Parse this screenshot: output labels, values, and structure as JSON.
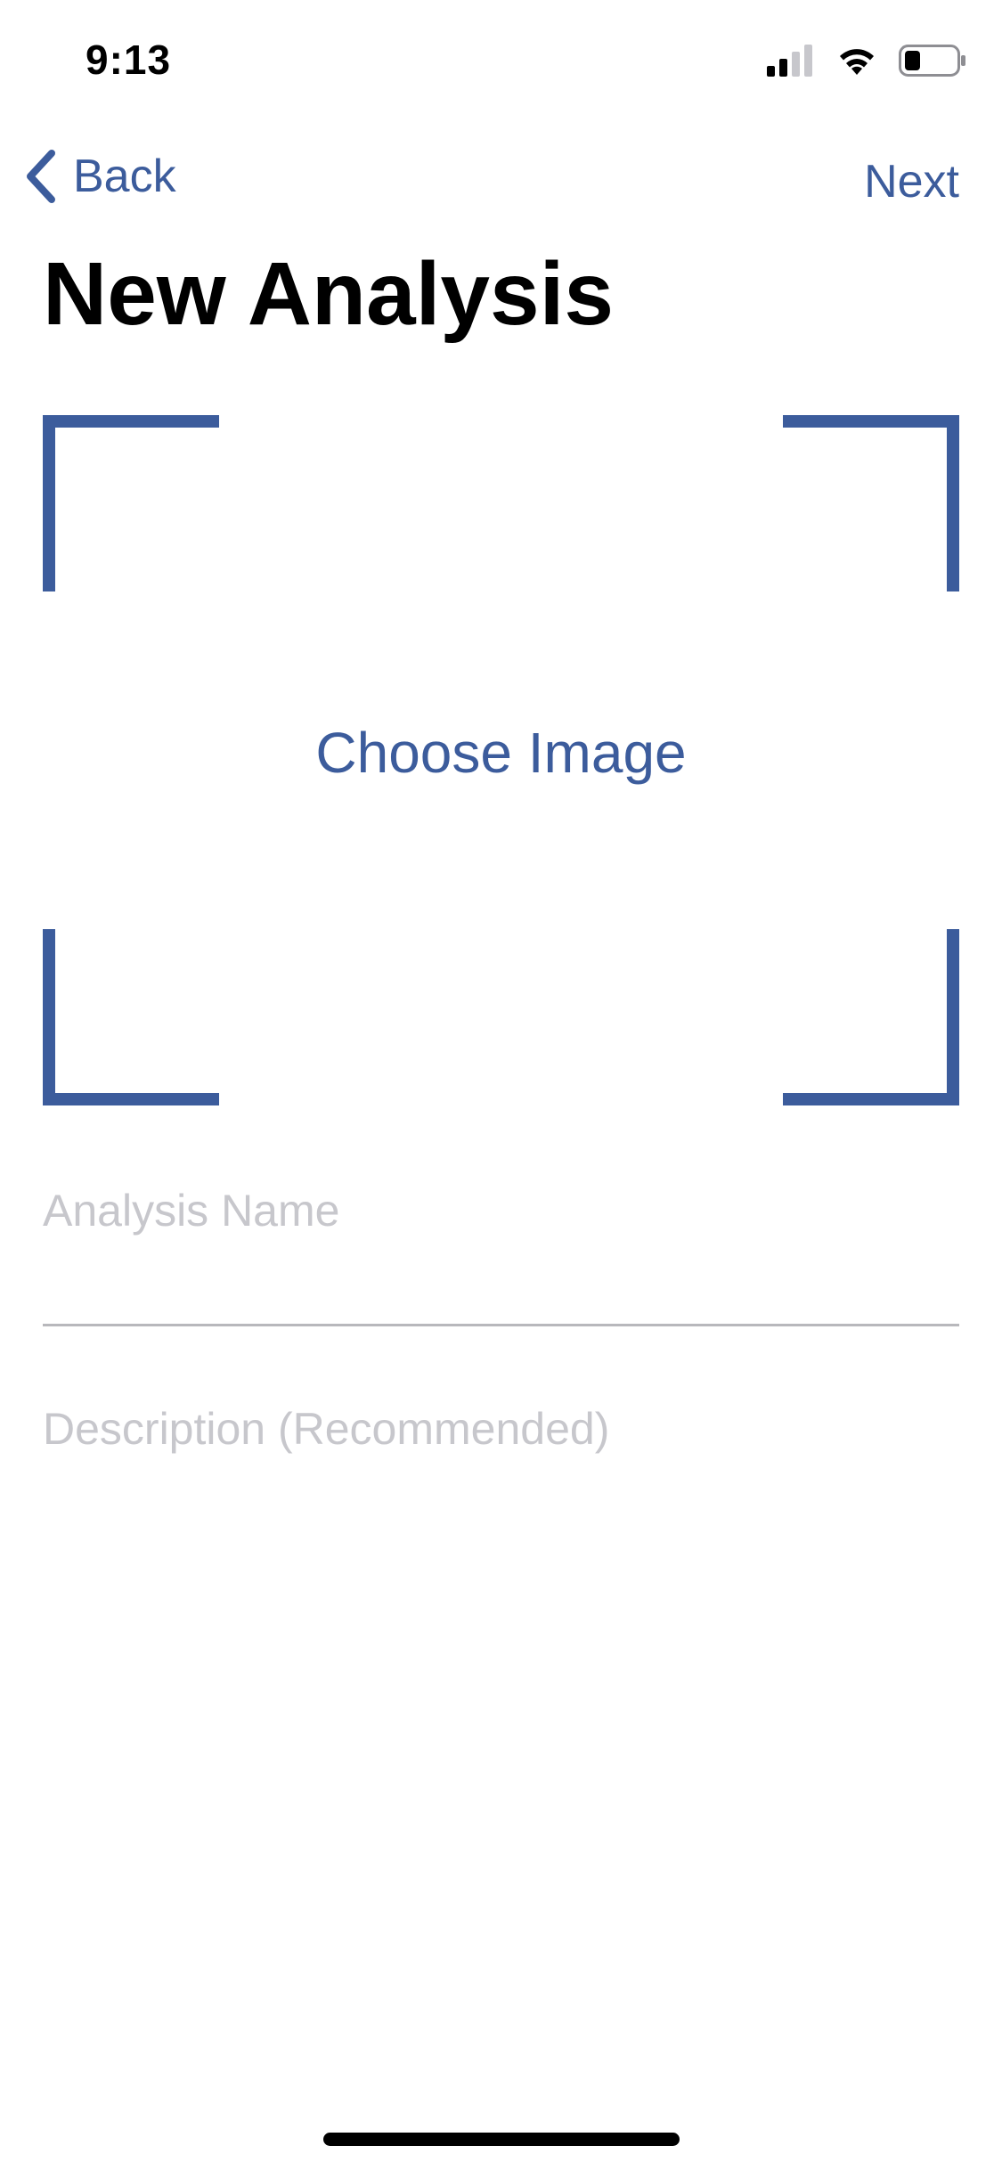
{
  "status_bar": {
    "time": "9:13",
    "icons": [
      "signal-icon",
      "wifi-icon",
      "battery-icon"
    ]
  },
  "nav": {
    "back_icon": "chevron-left-icon",
    "back_label": "Back",
    "next_label": "Next"
  },
  "title": "New Analysis",
  "image_picker": {
    "label": "Choose Image"
  },
  "form": {
    "name_value": "",
    "name_placeholder": "Analysis Name",
    "description_value": "",
    "description_placeholder": "Description (Recommended)"
  },
  "colors": {
    "accent": "#3c5c9c",
    "placeholder": "#c7c7cc",
    "divider": "#b8b8bc"
  }
}
